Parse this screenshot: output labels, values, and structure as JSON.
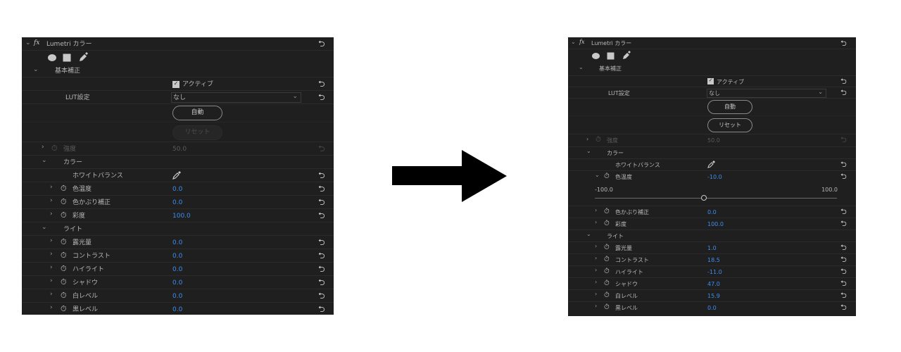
{
  "panel_title": "Lumetri カラー",
  "fx_label": "fx",
  "sections": {
    "basic": "基本補正",
    "color": "カラー",
    "light": "ライト"
  },
  "active": {
    "label": "アクティブ",
    "checked": true
  },
  "lut": {
    "label": "LUT設定",
    "value": "なし"
  },
  "auto_button": "自動",
  "reset_button": "リセット",
  "intensity": {
    "label": "強度",
    "value": "50.0"
  },
  "white_balance": "ホワイトバランス",
  "before": {
    "temperature": {
      "label": "色温度",
      "value": "0.0"
    },
    "tint": {
      "label": "色かぶり補正",
      "value": "0.0"
    },
    "saturation": {
      "label": "彩度",
      "value": "100.0"
    },
    "exposure": {
      "label": "露光量",
      "value": "0.0"
    },
    "contrast": {
      "label": "コントラスト",
      "value": "0.0"
    },
    "highlights": {
      "label": "ハイライト",
      "value": "0.0"
    },
    "shadows": {
      "label": "シャドウ",
      "value": "0.0"
    },
    "whites": {
      "label": "白レベル",
      "value": "0.0"
    },
    "blacks": {
      "label": "黒レベル",
      "value": "0.0"
    }
  },
  "after": {
    "temperature": {
      "label": "色温度",
      "value": "-10.0",
      "slider_min": "-100.0",
      "slider_max": "100.0",
      "slider_fraction": 0.45
    },
    "tint": {
      "label": "色かぶり補正",
      "value": "0.0"
    },
    "saturation": {
      "label": "彩度",
      "value": "100.0"
    },
    "exposure": {
      "label": "露光量",
      "value": "1.0"
    },
    "contrast": {
      "label": "コントラスト",
      "value": "18.5"
    },
    "highlights": {
      "label": "ハイライト",
      "value": "-11.0"
    },
    "shadows": {
      "label": "シャドウ",
      "value": "47.0"
    },
    "whites": {
      "label": "白レベル",
      "value": "15.9"
    },
    "blacks": {
      "label": "黒レベル",
      "value": "0.0"
    }
  },
  "icons": {
    "reset": "reset-arrow-icon",
    "stopwatch": "stopwatch-icon",
    "eyedropper": "eyedropper-icon"
  }
}
